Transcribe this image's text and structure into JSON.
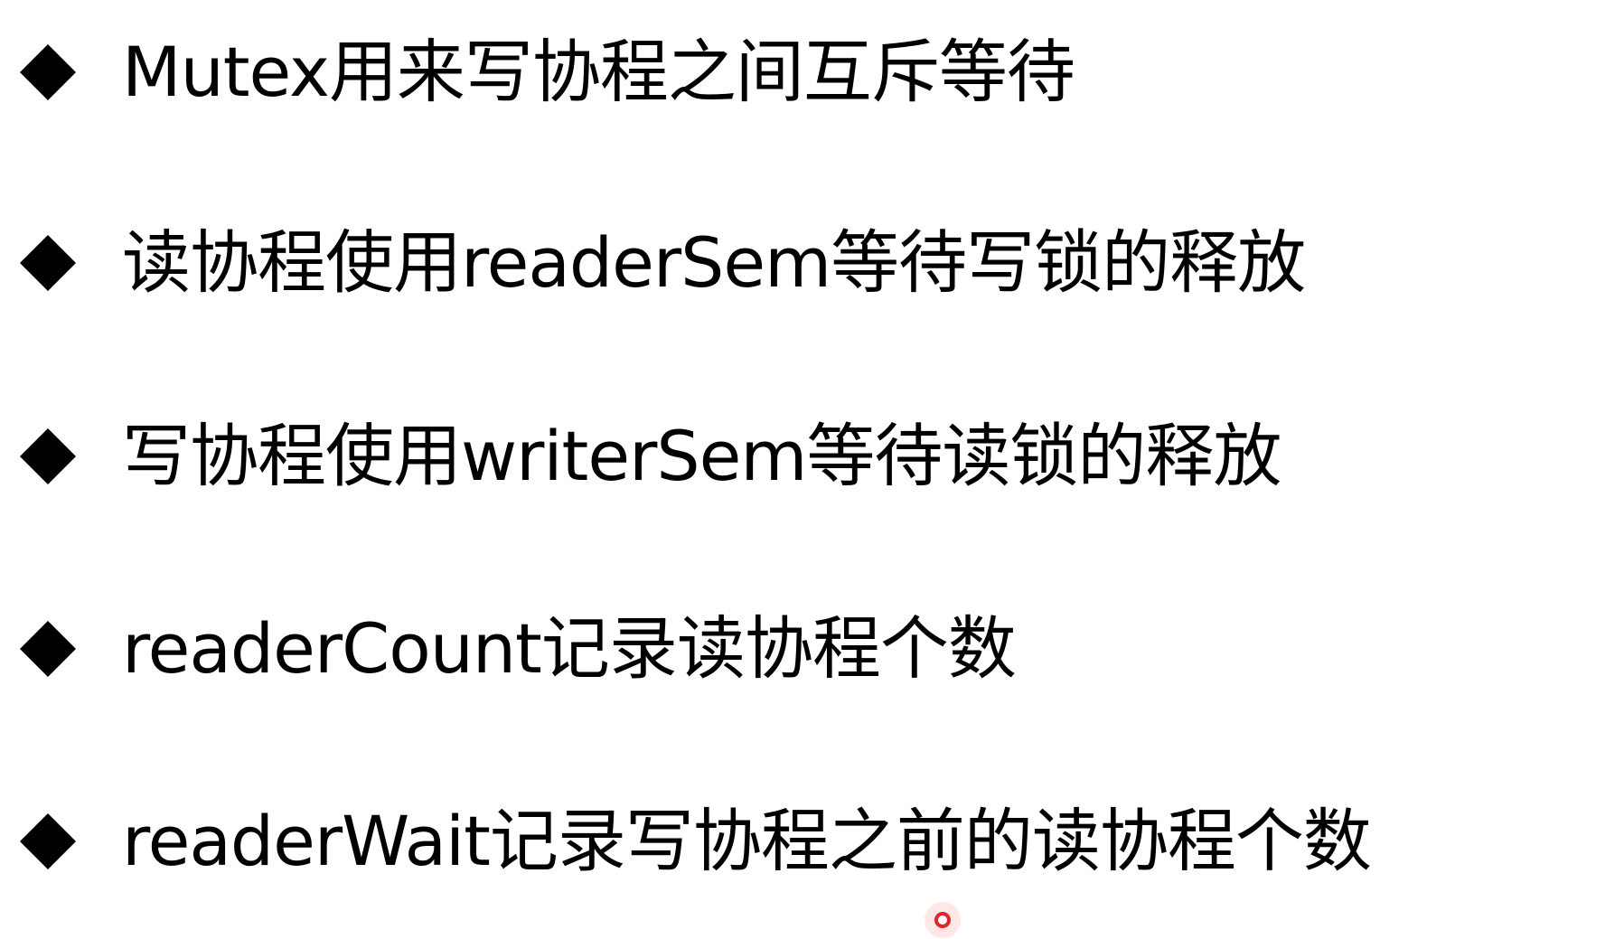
{
  "bullets": [
    {
      "icon": "diamond-bullet-icon",
      "text": "Mutex用来写协程之间互斥等待"
    },
    {
      "icon": "diamond-bullet-icon",
      "text": "读协程使用readerSem等待写锁的释放"
    },
    {
      "icon": "diamond-bullet-icon",
      "text": "写协程使用writerSem等待读锁的释放"
    },
    {
      "icon": "diamond-bullet-icon",
      "text": "readerCount记录读协程个数"
    },
    {
      "icon": "diamond-bullet-icon",
      "text": "readerWait记录写协程之前的读协程个数"
    }
  ],
  "colors": {
    "background": "#ffffff",
    "text": "#000000",
    "pointer": "#e0262c"
  },
  "pointer_icon": "laser-pointer-icon"
}
